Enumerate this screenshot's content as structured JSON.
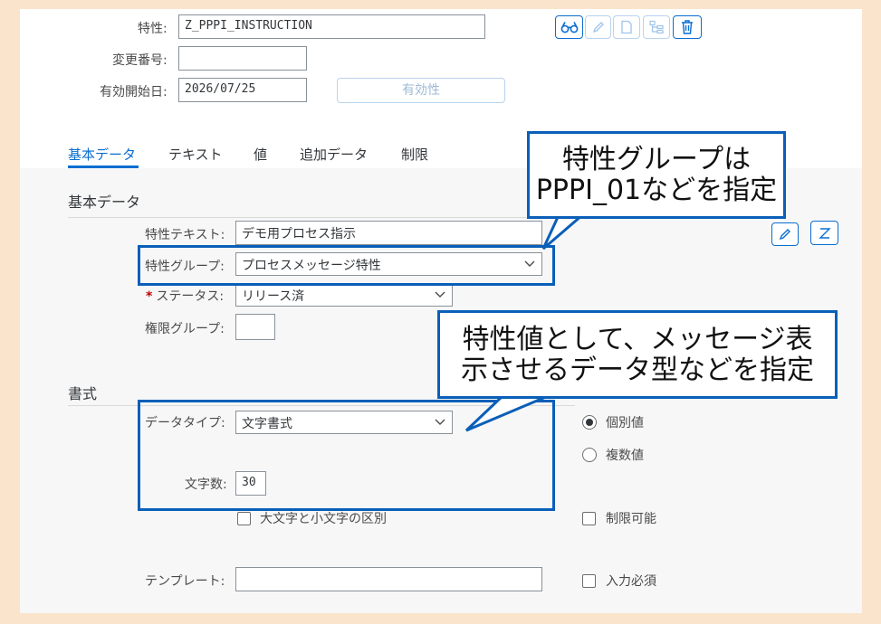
{
  "header": {
    "characteristic_label": "特性:",
    "characteristic_value": "Z_PPPI_INSTRUCTION",
    "change_number_label": "変更番号:",
    "change_number_value": "",
    "valid_from_label": "有効開始日:",
    "valid_from_value": "2026/07/25",
    "validity_button": "有効性"
  },
  "toolbar": {
    "icons": [
      "glasses-icon",
      "pencil-icon",
      "copy-icon",
      "tree-icon",
      "trash-icon"
    ]
  },
  "tabs": [
    {
      "label": "基本データ",
      "active": true
    },
    {
      "label": "テキスト",
      "active": false
    },
    {
      "label": "値",
      "active": false
    },
    {
      "label": "追加データ",
      "active": false
    },
    {
      "label": "制限",
      "active": false
    }
  ],
  "basic": {
    "section_title": "基本データ",
    "description_label": "特性テキスト:",
    "description_value": "デモ用プロセス指示",
    "group_label": "特性グループ:",
    "group_value": "プロセスメッセージ特性",
    "status_required": "*",
    "status_label": "ステータス:",
    "status_value": "リリース済",
    "auth_group_label": "権限グループ:",
    "auth_group_value": ""
  },
  "format": {
    "section_title": "書式",
    "data_type_label": "データタイプ:",
    "data_type_value": "文字書式",
    "length_label": "文字数:",
    "length_value": "30",
    "case_sensitive_label": "大文字と小文字の区別",
    "template_label": "テンプレート:",
    "template_value": "",
    "single_value_label": "個別値",
    "multiple_values_label": "複数値",
    "single_value_selected": true,
    "restrictable_label": "制限可能",
    "entry_required_label": "入力必須"
  },
  "callouts": {
    "group_note_line1": "特性グループは",
    "group_note_line2": "PPPI_01などを指定",
    "value_note_line1": "特性値として、メッセージ表",
    "value_note_line2": "示させるデータ型などを指定"
  },
  "colors": {
    "background": "#fbe4cc",
    "accent": "#0a6ed1",
    "callout_border": "#0a5fb8"
  }
}
